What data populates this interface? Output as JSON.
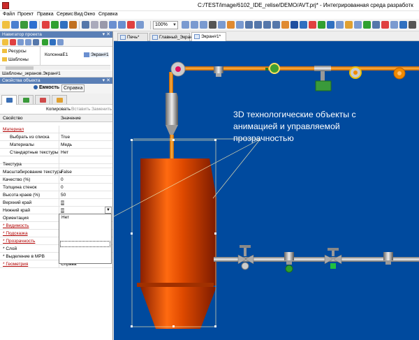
{
  "window": {
    "title": "C:/TEST/image/6102_IDE_relise/DEMO/AVT.prj* - Интегрированная среда разработк"
  },
  "menu": [
    "Файл",
    "Проект",
    "Правка",
    "Сервис",
    "Вид",
    "Окно",
    "Справка"
  ],
  "toolbar": {
    "zoom": "100%"
  },
  "navigator": {
    "title": "Навигатор проекта",
    "tree": [
      "Ресурсы",
      "Шаблоны"
    ],
    "list": [
      "КолоннаЕ1",
      "Экран#1"
    ],
    "path": "Шаблоны_экранов.Экран#1"
  },
  "properties": {
    "title": "Свойства объекта",
    "tab_object": "Емкость",
    "tab_help": "Справка",
    "copy": "Копировать",
    "paste": "Вставить",
    "replace": "Заменить",
    "col_property": "Свойство",
    "col_value": "Значение",
    "rows": [
      {
        "k": "Материал",
        "v": ""
      },
      {
        "k": "Выбрать из списка",
        "v": "True"
      },
      {
        "k": "Материалы",
        "v": "Медь"
      },
      {
        "k": "Стандартные текстуры",
        "v": "Нет"
      },
      {
        "k": "",
        "v": ""
      },
      {
        "k": "Текстура",
        "v": ""
      },
      {
        "k": "Масштабирование текстуры",
        "v": "False"
      },
      {
        "k": "Качество (%)",
        "v": "0"
      },
      {
        "k": "Толщина стенок",
        "v": "0"
      },
      {
        "k": "Высота краев (%)",
        "v": "50"
      },
      {
        "k": "Верхний край",
        "v": ""
      },
      {
        "k": "Нижний край",
        "v": ""
      },
      {
        "k": "Ориентация",
        "v": ""
      },
      {
        "k": "* Видимость",
        "v": ""
      },
      {
        "k": "* Подсказка",
        "v": ""
      },
      {
        "k": "* Прозрачность",
        "v": ""
      },
      {
        "k": "* Слой",
        "v": ""
      },
      {
        "k": "* Выделение в МРВ",
        "v": ""
      },
      {
        "k": "* Геометрия",
        "v": "Справа"
      }
    ],
    "dropdown": [
      "Нет"
    ]
  },
  "doc_tabs": [
    "Печь*",
    "Главный_Экран",
    "Экран#1*"
  ],
  "canvas": {
    "annotation": "3D технологические объекты с анимацией и управляемой прозрачностью",
    "colors": {
      "background": "#004a9e",
      "pipe": "#f08a00",
      "vessel": "#e04a00",
      "annotation": "#ffffff"
    }
  }
}
